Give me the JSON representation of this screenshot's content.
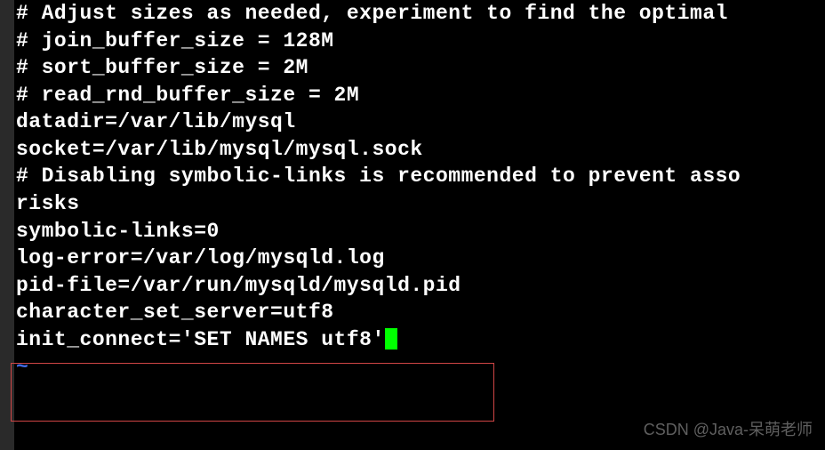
{
  "terminal": {
    "lines": [
      "# Adjust sizes as needed, experiment to find the optimal",
      "# join_buffer_size = 128M",
      "# sort_buffer_size = 2M",
      "# read_rnd_buffer_size = 2M",
      "datadir=/var/lib/mysql",
      "socket=/var/lib/mysql/mysql.sock",
      "",
      "# Disabling symbolic-links is recommended to prevent asso",
      "risks",
      "symbolic-links=0",
      "",
      "log-error=/var/log/mysqld.log",
      "pid-file=/var/run/mysqld/mysqld.pid",
      "character_set_server=utf8",
      "init_connect='SET NAMES utf8'"
    ],
    "tilde": "~",
    "cursor_visible": true
  },
  "watermark": "CSDN @Java-呆萌老师"
}
